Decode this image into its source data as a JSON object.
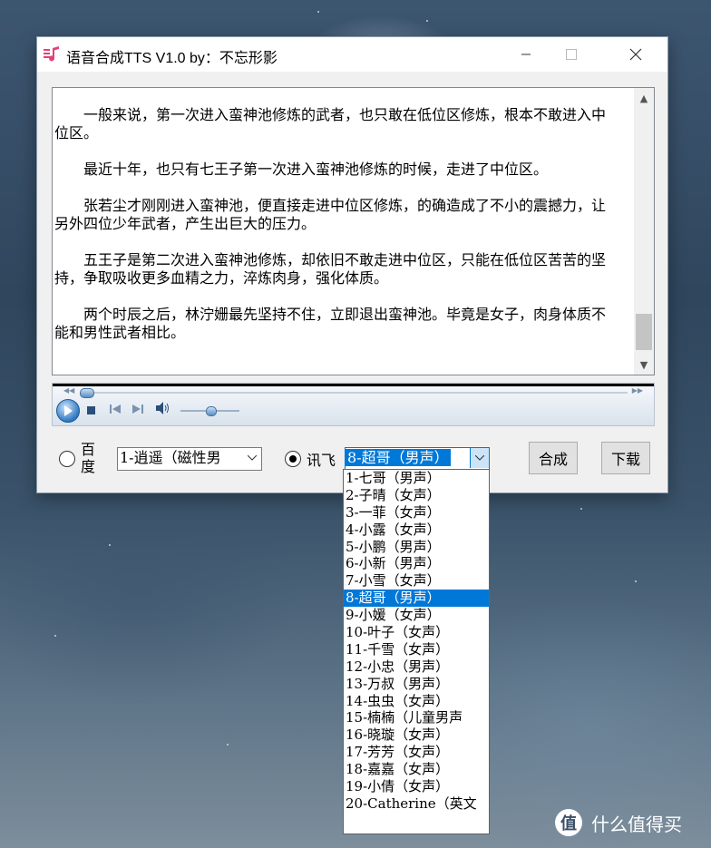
{
  "window": {
    "title": "语音合成TTS V1.0 by：不忘形影",
    "minimize_icon": "minimize-icon",
    "maximize_icon": "maximize-icon",
    "close_icon": "close-icon"
  },
  "text_area": {
    "paragraphs": [
      "一般来说，第一次进入蛮神池修炼的武者，也只敢在低位区修炼，根本不敢进入中位区。",
      "最近十年，也只有七王子第一次进入蛮神池修炼的时候，走进了中位区。",
      "张若尘才刚刚进入蛮神池，便直接走进中位区修炼，的确造成了不小的震撼力，让另外四位少年武者，产生出巨大的压力。",
      "五王子是第二次进入蛮神池修炼，却依旧不敢走进中位区，只能在低位区苦苦的坚持，争取吸收更多血精之力，淬炼肉身，强化体质。",
      "两个时辰之后，林泞姗最先坚持不住，立即退出蛮神池。毕竟是女子，肉身体质不能和男性武者相比。"
    ]
  },
  "player": {
    "state": "stopped",
    "seek_position": 0.0,
    "volume": 0.5
  },
  "engines": {
    "baidu": {
      "label": "百度",
      "selected": false,
      "voice": "1-逍遥（磁性男"
    },
    "xunfei": {
      "label": "讯飞",
      "selected": true,
      "voice": "8-超哥（男声）"
    }
  },
  "buttons": {
    "synthesize": "合成",
    "download": "下载"
  },
  "voice_dropdown": {
    "selected_index": 7,
    "items": [
      "1-七哥（男声）",
      "2-子晴（女声）",
      "3-一菲（女声）",
      "4-小露（女声）",
      "5-小鹏（男声）",
      "6-小新（男声）",
      "7-小雪（女声）",
      "8-超哥（男声）",
      "9-小媛（女声）",
      "10-叶子（女声）",
      "11-千雪（女声）",
      "12-小忠（男声）",
      "13-万叔（男声）",
      "14-虫虫（女声）",
      "15-楠楠（儿童男声",
      "16-晓璇（女声）",
      "17-芳芳（女声）",
      "18-嘉嘉（女声）",
      "19-小倩（女声）",
      "20-Catherine（英文"
    ]
  },
  "watermark": {
    "logo": "值",
    "text": "什么值得买"
  }
}
